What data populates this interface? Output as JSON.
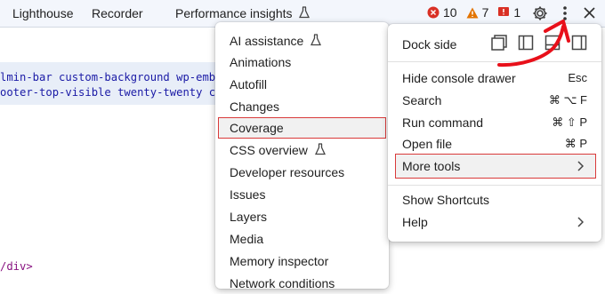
{
  "tabs": {
    "lighthouse": "Lighthouse",
    "recorder": "Recorder",
    "performance": "Performance insights"
  },
  "badges": {
    "errors": "10",
    "warnings": "7",
    "issues": "1"
  },
  "code": {
    "line1": "lmin-bar custom-background wp-embed-",
    "line2": "ooter-top-visible twenty-twenty cust",
    "closing": "/div>"
  },
  "more_tools_menu": {
    "items": [
      "AI assistance",
      "Animations",
      "Autofill",
      "Changes",
      "Coverage",
      "CSS overview",
      "Developer resources",
      "Issues",
      "Layers",
      "Media",
      "Memory inspector",
      "Network conditions"
    ]
  },
  "main_menu": {
    "dock_side": "Dock side",
    "hide_console": "Hide console drawer",
    "hide_console_sc": "Esc",
    "search": "Search",
    "search_sc": "⌘ ⌥ F",
    "run_command": "Run command",
    "run_command_sc": "⌘ ⇧ P",
    "open_file": "Open file",
    "open_file_sc": "⌘ P",
    "more_tools": "More tools",
    "show_shortcuts": "Show Shortcuts",
    "help": "Help"
  },
  "colors": {
    "highlight_border": "#d93a3a",
    "annotation_arrow": "#e8101a",
    "error": "#d93025",
    "warning": "#e37400"
  }
}
